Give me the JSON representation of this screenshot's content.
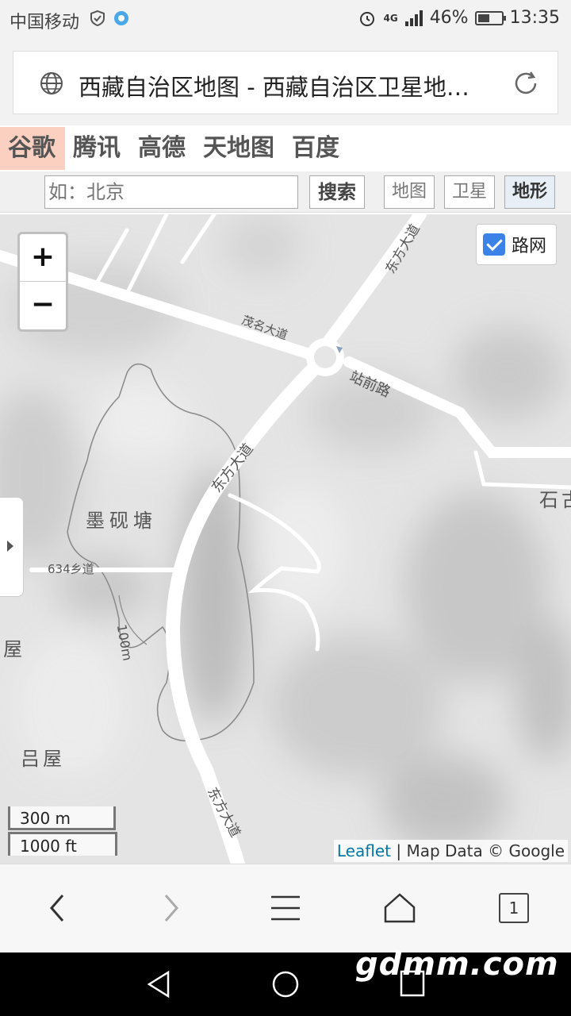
{
  "status_bar": {
    "carrier": "中国移动",
    "network": "4G",
    "battery": "46%",
    "time": "13:35"
  },
  "url_bar": {
    "title": "西藏自治区地图 - 西藏自治区卫星地…"
  },
  "providers": [
    "谷歌",
    "腾讯",
    "高德",
    "天地图",
    "百度"
  ],
  "active_provider": "谷歌",
  "search": {
    "placeholder": "如：北京",
    "button": "搜索"
  },
  "map_modes": [
    "地图",
    "卫星",
    "地形"
  ],
  "active_mode": "地形",
  "map": {
    "zoom_in": "+",
    "zoom_out": "−",
    "road_layer_label": "路网",
    "road_layer_checked": true,
    "labels": {
      "road_dongfang_top": "东方大道",
      "road_maoming": "茂名大道",
      "road_zhanqian": "站前路",
      "road_dongfang_mid": "东方大道",
      "road_dongfang_bottom": "东方大道",
      "place_moyantang": "墨砚塘",
      "road_634": "634乡道",
      "contour_100m": "100m",
      "place_shi": "石古",
      "place_wu": "屋",
      "place_lvwu": "吕屋"
    },
    "scale": {
      "metric": "300 m",
      "imperial": "1000 ft"
    },
    "attribution": {
      "leaflet": "Leaflet",
      "data": "| Map Data © Google"
    }
  },
  "browser_nav": {
    "tab_count": "1"
  },
  "watermark": "gdmm.com"
}
